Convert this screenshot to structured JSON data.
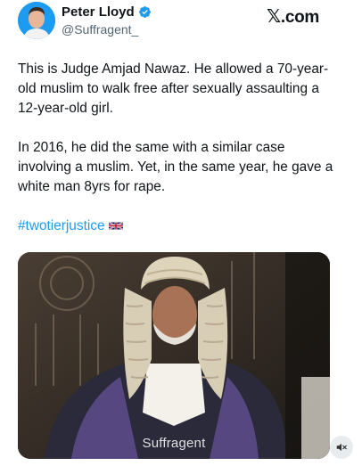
{
  "author": {
    "display_name": "Peter Lloyd",
    "handle": "@Suffragent_",
    "verified": true,
    "avatar_icon": "avatar-icon"
  },
  "brand": {
    "label": ".com",
    "logo_icon": "x-logo-icon"
  },
  "tweet": {
    "paragraphs": [
      "This is Judge Amjad Nawaz. He allowed a 70-year-old muslim to walk free after sexually assaulting a 12-year-old girl.",
      "In 2016, he did the same with a similar case involving a muslim. Yet, in the same year, he gave a white man 8yrs for rape."
    ],
    "hashtag": "#twotierjustice",
    "flag_icon": "uk-flag-icon"
  },
  "media": {
    "watermark": "Suffragent"
  },
  "controls": {
    "mute_icon": "speaker-muted-icon"
  },
  "colors": {
    "link": "#1d9bf0",
    "verified": "#1d9bf0",
    "text": "#0f1419",
    "secondary": "#536471"
  }
}
